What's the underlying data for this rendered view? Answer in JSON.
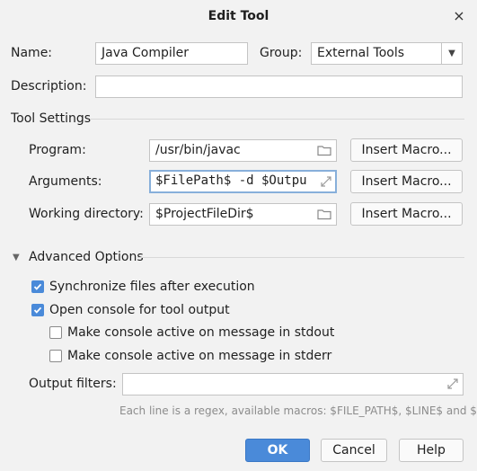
{
  "dialog": {
    "title": "Edit Tool",
    "close_symbol": "×"
  },
  "name": {
    "label": "Name:",
    "value": "Java Compiler"
  },
  "group": {
    "label": "Group:",
    "value": "External Tools"
  },
  "description": {
    "label": "Description:",
    "value": ""
  },
  "tool_settings": {
    "heading": "Tool Settings",
    "program": {
      "label": "Program:",
      "value": "/usr/bin/javac",
      "macro_button": "Insert Macro..."
    },
    "arguments": {
      "label": "Arguments:",
      "value": "$FilePath$ -d $Outpu",
      "macro_button": "Insert Macro..."
    },
    "working_dir": {
      "label": "Working directory:",
      "value": "$ProjectFileDir$",
      "macro_button": "Insert Macro..."
    }
  },
  "advanced": {
    "heading": "Advanced Options",
    "options": [
      {
        "label": "Synchronize files after execution",
        "checked": true
      },
      {
        "label": "Open console for tool output",
        "checked": true
      },
      {
        "label": "Make console active on message in stdout",
        "checked": false
      },
      {
        "label": "Make console active on message in stderr",
        "checked": false
      }
    ],
    "output_filters": {
      "label": "Output filters:",
      "value": ""
    },
    "hint": "Each line is a regex, available macros: $FILE_PATH$, $LINE$ and $..."
  },
  "buttons": {
    "ok": "OK",
    "cancel": "Cancel",
    "help": "Help"
  },
  "colors": {
    "accent": "#4a8ad9",
    "focus_border": "#87afda",
    "background": "#f2f2f2"
  }
}
